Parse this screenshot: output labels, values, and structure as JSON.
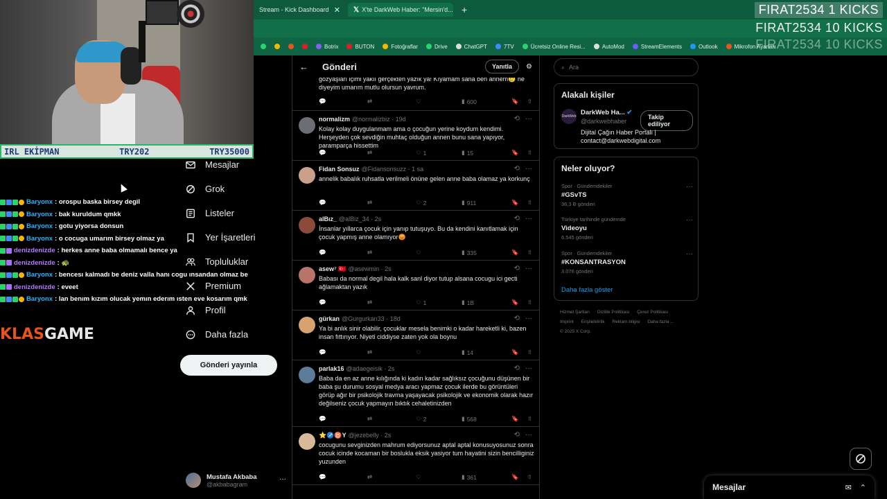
{
  "browser": {
    "tabs": [
      {
        "label": "Stream - Kick Dashboard"
      },
      {
        "label": "X'te DarkWeb Haber: \"Mersin'd..."
      }
    ],
    "bookmarks": [
      "Botrix",
      "BUTON",
      "Fotoğraflar",
      "Drive",
      "ChatGPT",
      "7TV",
      "Ücretsiz Online Resi...",
      "AutoMod",
      "StreamElements",
      "Outlook",
      "Mikrofon Ayarları"
    ]
  },
  "overlay": {
    "kicks": [
      "FIRAT2534  1 KICKS",
      "FIRAT2534  10 KICKS",
      "FIRAT2534  10 KICKS"
    ],
    "irl_bar": {
      "left": "IRL EKİPMAN",
      "mid": "TRY202",
      "right": "TRY35000"
    },
    "brand_a": "KLAS",
    "brand_b": "GAME",
    "chat": [
      {
        "user": "Baryonx",
        "badges": "mod",
        "msg": ": orospu baska birsey degil"
      },
      {
        "user": "Baryonx",
        "badges": "mod",
        "msg": ": bak kuruldum qmkk"
      },
      {
        "user": "Baryonx",
        "badges": "mod",
        "msg": ": gotu yiyorsa donsun"
      },
      {
        "user": "Baryonx",
        "badges": "mod",
        "msg": ": o cocuga umarım birsey olmaz ya"
      },
      {
        "user": "denizdenizde",
        "badges": "sub",
        "msg": ": herkes anne baba olmamalı bence ya"
      },
      {
        "user": "denizdenizde",
        "badges": "sub",
        "msg": ": 🐢"
      },
      {
        "user": "Baryonx",
        "badges": "mod",
        "msg": ": bencesı kalmadı be deniz valla hanı cogu ınsandan olmaz be"
      },
      {
        "user": "denizdenizde",
        "badges": "sub",
        "msg": ": eveet"
      },
      {
        "user": "Baryonx",
        "badges": "mod",
        "msg": ": lan benım kızım olucak yemın ederım ısten eve kosarım qmk"
      }
    ]
  },
  "nav": {
    "items": [
      {
        "label": "Mesajlar",
        "icon": "envelope-icon"
      },
      {
        "label": "Grok",
        "icon": "grok-icon"
      },
      {
        "label": "Listeler",
        "icon": "list-icon"
      },
      {
        "label": "Yer İşaretleri",
        "icon": "bookmark-icon"
      },
      {
        "label": "Topluluklar",
        "icon": "people-icon"
      },
      {
        "label": "Premium",
        "icon": "x-icon"
      },
      {
        "label": "Profil",
        "icon": "person-icon"
      },
      {
        "label": "Daha fazla",
        "icon": "more-circle-icon"
      }
    ],
    "post_button": "Gönderi yayınla",
    "profile": {
      "name": "Mustafa Akbaba",
      "handle": "@akbabagram"
    }
  },
  "timeline": {
    "header": {
      "title": "Gönderi",
      "reply_button": "Yanıtla"
    },
    "top_text": "gözyaşları içimi yakıı gerçekten yazık ya! Kıyamam sana ben annem🥲 ne diyeyim umarım mutlu olursun yavrum.",
    "top_stats": {
      "replies": "",
      "reposts": "",
      "likes": "",
      "views": "600"
    },
    "tweets": [
      {
        "name": "normalizm",
        "handle": "@normalizbiz · 19d",
        "text": "Kolay kolay duygulanmam ama o çocuğun yerine koydum kendimi. Herşeyden çok sevdiğin muhtaç olduğun annen bunu sana yapıyor, paramparça hissettim",
        "likes": "1",
        "views": "15"
      },
      {
        "name": "Fidan Sonsuz",
        "handle": "@Fidansonsuzz · 1 sa",
        "text": "annelik babalık ruhsatla verilmeli önüne gelen anne baba olamaz ya korkunç",
        "likes": "2",
        "views": "911"
      },
      {
        "name": "alBız_",
        "handle": "@alBiz_34 · 2s",
        "text": "İnsanlar yıllarca çocuk için yanıp tutuşuyo. Bu da kendini kanıtlamak için çocuk yapmış anne olamıyor😡",
        "likes": "",
        "views": "335"
      },
      {
        "name": "asew⁷ 🇹🇷",
        "handle": "@asewmin · 2s",
        "text": "Babası da normal degil hala kalk sanl diyor tutup alsana cocugu ici gecti ağlamaktan yazık",
        "likes": "1",
        "views": "1B"
      },
      {
        "name": "gürkan",
        "handle": "@Gurgurkan33 · 18d",
        "text": "Ya bi anlık sinir olabilir, çocuklar mesela benimki o kadar hareketli ki, bazen insan fıttırıyor. Niyeti ciddiyse zaten yok ola boynu",
        "likes": "",
        "views": "14"
      },
      {
        "name": "parlak16",
        "handle": "@adaegeisik · 2s",
        "text": "Baba da  en az anne kılığında ki kadın kadar sağlıksız çocuğunu düşünen bir baba şu durumu sosyal medya aracı yapmaz çocuk ilerde bu görüntüleri görüp ağır bir psikolojik travma yaşayacak psikolojik ve ekonomik olarak hazır değilseniz çocuk yapmayın bıktık cehaletinizden",
        "likes": "2",
        "views": "568"
      },
      {
        "name": "⭐♐♉Y",
        "handle": "@jezebelly · 2s",
        "text": "cocugunu sevginizden mahrum ediyorsunuz aptal aptal konusuyosunuz sonra cocuk icinde kocaman bir boslukla eksik yasiyor tum hayatini sizin bencilliginiz yuzunden",
        "likes": "",
        "views": "361"
      }
    ]
  },
  "right": {
    "search_placeholder": "Ara",
    "related_title": "Alakalı kişiler",
    "related": {
      "name": "DarkWeb Ha...",
      "handle": "@darkwebhaber",
      "follow": "Takip ediliyor",
      "bio": "Dijital Çağın Haber Portalı | contact@darkwebdigital.com",
      "avatar_text": "DarkWeb"
    },
    "trends_title": "Neler oluyor?",
    "trends": [
      {
        "context": "Spor · Gündemdekiler",
        "topic": "#GSvTS",
        "count": "36,3 B gönderi"
      },
      {
        "context": "Türkiye tarihinde gündemde",
        "topic": "Videoyu",
        "count": "6.545 gönderi"
      },
      {
        "context": "Spor · Gündemdekiler",
        "topic": "#KONSANTRASYON",
        "count": "3.076 gönderi"
      }
    ],
    "show_more": "Daha fazla göster",
    "footer": [
      "Hizmet Şartları",
      "Gizlilik Politikası",
      "Çerez Politikası",
      "Imprint",
      "Erişilebilirlik",
      "Reklam bilgisi",
      "Daha fazla ...",
      "© 2025 X Corp."
    ],
    "dm_title": "Mesajlar"
  },
  "colors": {
    "kick_green": "#0e5a3e",
    "x_blue": "#1d9bf0",
    "chat_user": "#1fb6ff",
    "chat_sub": "#b57cff"
  }
}
